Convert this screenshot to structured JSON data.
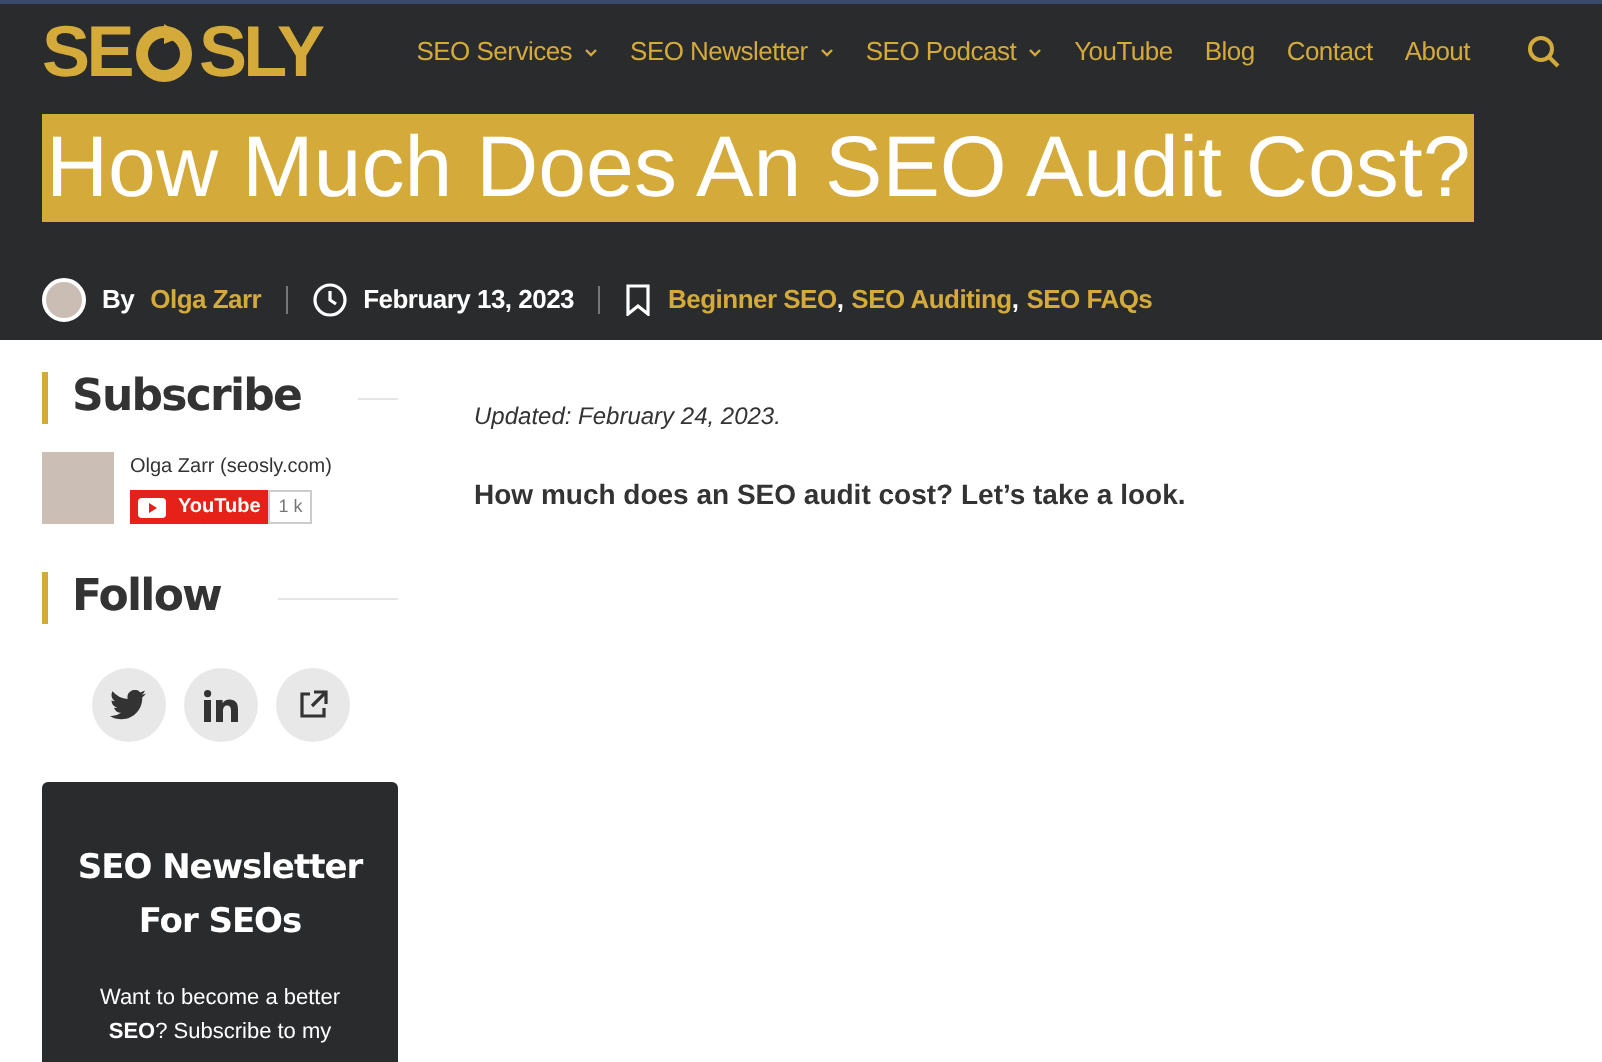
{
  "logo": {
    "before": "SE",
    "after": "SLY"
  },
  "nav": [
    {
      "label": "SEO Services",
      "has_menu": true
    },
    {
      "label": "SEO Newsletter",
      "has_menu": true
    },
    {
      "label": "SEO Podcast",
      "has_menu": true
    },
    {
      "label": "YouTube",
      "has_menu": false
    },
    {
      "label": "Blog",
      "has_menu": false
    },
    {
      "label": "Contact",
      "has_menu": false
    },
    {
      "label": "About",
      "has_menu": false
    }
  ],
  "title": "How Much Does An SEO Audit Cost?",
  "meta": {
    "by": "By",
    "author": "Olga Zarr",
    "date": "February 13, 2023",
    "categories": [
      "Beginner SEO",
      "SEO Auditing",
      "SEO FAQs"
    ],
    "separator": ","
  },
  "sidebar": {
    "subscribe": {
      "heading": "Subscribe",
      "channel": "Olga Zarr (seosly.com)",
      "button": "YouTube",
      "count": "1 k"
    },
    "follow": {
      "heading": "Follow"
    },
    "newsletter": {
      "title": "SEO Newsletter For SEOs",
      "text": "Want to become a better **SEO**? Subscribe to my"
    }
  },
  "article": {
    "updated": "Updated: February 24, 2023.",
    "intro": "How much does an SEO audit cost? Let’s take a look."
  }
}
